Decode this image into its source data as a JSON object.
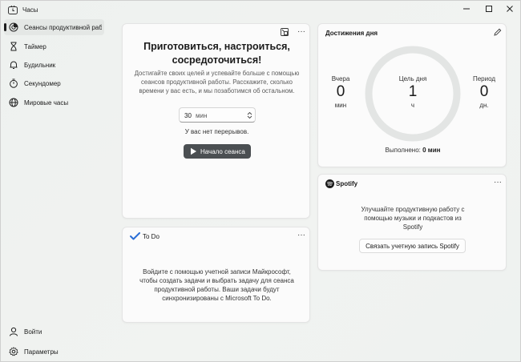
{
  "window": {
    "title": "Часы"
  },
  "sidebar": {
    "items": [
      {
        "label": "Сеансы продуктивной работы"
      },
      {
        "label": "Таймер"
      },
      {
        "label": "Будильник"
      },
      {
        "label": "Секундомер"
      },
      {
        "label": "Мировые часы"
      }
    ],
    "signin_label": "Войти",
    "settings_label": "Параметры"
  },
  "focus": {
    "heading_line1": "Приготовиться, настроиться,",
    "heading_line2": "сосредоточиться!",
    "description_line1": "Достигайте своих целей и успевайте больше с помощью",
    "description_line2": "сеансов продуктивной работы. Расскажите, сколько",
    "description_line3": "времени у вас есть, и мы позаботимся об остальном.",
    "duration_value": "30",
    "duration_unit": "мин",
    "breaks_text": "У вас нет перерывов.",
    "start_label": "Начало сеанса"
  },
  "daily": {
    "title": "Достижения дня",
    "yesterday_label": "Вчера",
    "yesterday_value": "0",
    "yesterday_unit": "мин",
    "goal_label": "Цель дня",
    "goal_value": "1",
    "goal_unit": "ч",
    "streak_label": "Период",
    "streak_value": "0",
    "streak_unit": "дн.",
    "completed_label": "Выполнено:",
    "completed_value": "0 мин",
    "goal_progress": 0
  },
  "spotify": {
    "title": "Spotify",
    "text_line1": "Улучшайте продуктивную работу с",
    "text_line2": "помощью музыки и подкастов из",
    "text_line3": "Spotify",
    "link_label": "Связать учетную запись Spotify"
  },
  "todo": {
    "title": "To Do",
    "text_line1": "Войдите с помощью учетной записи Майкрософт,",
    "text_line2": "чтобы создать задачи и выбрать задачу для сеанса",
    "text_line3": "продуктивной работы. Ваши задачи будут",
    "text_line4": "синхронизированы с Microsoft To Do."
  },
  "more_glyph": "···",
  "colors": {
    "accent_dark": "#4b4f52",
    "ring": "#e3e5e4",
    "spotify": "#1a1a1a",
    "todo_check": "#2b6fd6"
  }
}
